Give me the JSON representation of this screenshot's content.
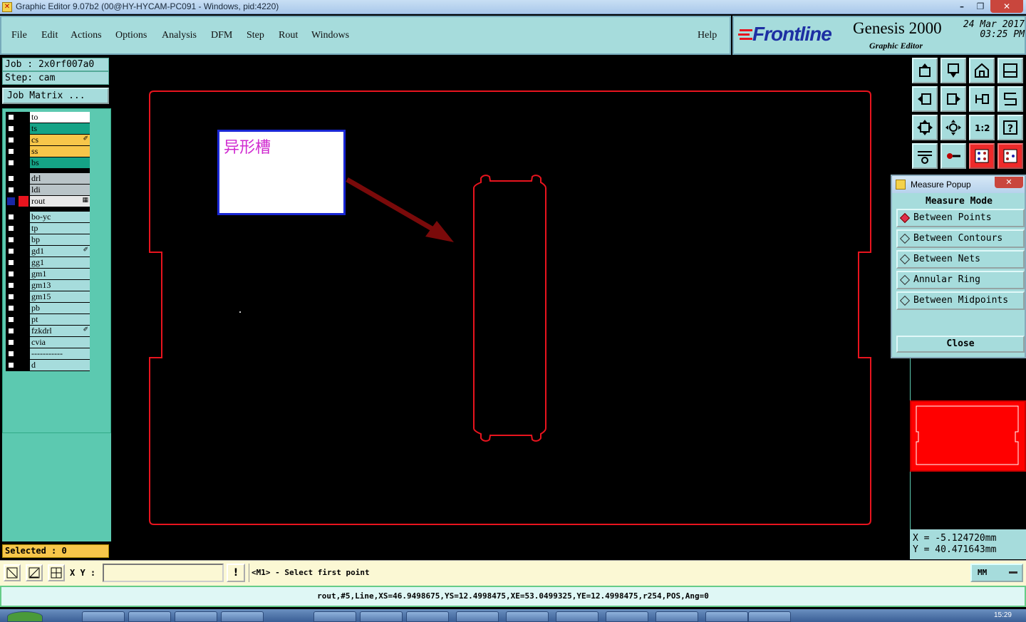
{
  "window": {
    "title": "Graphic Editor 9.07b2 (00@HY-HYCAM-PC091 - Windows, pid:4220)",
    "controls": {
      "minimize": "–",
      "maximize": "❐",
      "close": "✕"
    }
  },
  "menu": {
    "items": [
      "File",
      "Edit",
      "Actions",
      "Options",
      "Analysis",
      "DFM",
      "Step",
      "Rout",
      "Windows"
    ],
    "help": "Help"
  },
  "logo": {
    "brand": "Frontline",
    "product": "Genesis 2000",
    "subtitle": "Graphic Editor",
    "date": "24 Mar 2017",
    "time": "03:25 PM"
  },
  "left": {
    "job": "Job  : 2x0rf007a0",
    "step": "Step: cam",
    "job_matrix": "Job Matrix ...",
    "layers": [
      {
        "name": "to",
        "color": "#ffffff",
        "mark": ""
      },
      {
        "name": "ts",
        "color": "#15a386",
        "mark": ""
      },
      {
        "name": "cs",
        "color": "#f7c64a",
        "mark": "✐"
      },
      {
        "name": "ss",
        "color": "#f7c64a",
        "mark": ""
      },
      {
        "name": "bs",
        "color": "#15a386",
        "mark": ""
      },
      {
        "name": "drl",
        "color": "#b9c4c8",
        "mark": ""
      },
      {
        "name": "ldi",
        "color": "#b9c4c8",
        "mark": ""
      },
      {
        "name": "rout",
        "color": "#e8e8e8",
        "mark": "▦",
        "active": true
      },
      {
        "name": "bo-yc",
        "color": "#a6dcdc",
        "mark": ""
      },
      {
        "name": "tp",
        "color": "#a6dcdc",
        "mark": ""
      },
      {
        "name": "bp",
        "color": "#a6dcdc",
        "mark": ""
      },
      {
        "name": "gd1",
        "color": "#a6dcdc",
        "mark": "✐"
      },
      {
        "name": "gg1",
        "color": "#a6dcdc",
        "mark": ""
      },
      {
        "name": "gm1",
        "color": "#a6dcdc",
        "mark": ""
      },
      {
        "name": "gm13",
        "color": "#a6dcdc",
        "mark": ""
      },
      {
        "name": "gm15",
        "color": "#a6dcdc",
        "mark": ""
      },
      {
        "name": "pb",
        "color": "#a6dcdc",
        "mark": ""
      },
      {
        "name": "pt",
        "color": "#a6dcdc",
        "mark": ""
      },
      {
        "name": "fzkdrl",
        "color": "#a6dcdc",
        "mark": "✐"
      },
      {
        "name": "cvia",
        "color": "#a6dcdc",
        "mark": ""
      },
      {
        "name": "-----------",
        "color": "#a6dcdc",
        "mark": ""
      },
      {
        "name": "d",
        "color": "#a6dcdc",
        "mark": ""
      }
    ],
    "selected": "Selected : 0"
  },
  "canvas": {
    "callout_text": "异形槽",
    "outline_color": "#e8141e",
    "callout_border": "#1927d5",
    "arrow_color": "#7a0a0a"
  },
  "measure_popup": {
    "title": "Measure Popup",
    "mode_label": "Measure Mode",
    "options": [
      "Between Points",
      "Between Contours",
      "Between Nets",
      "Annular Ring",
      "Between Midpoints"
    ],
    "selected_option": "Between Points",
    "close_label": "Close"
  },
  "coords": {
    "x": "X  =  -5.124720mm",
    "y": "Y  =  40.471643mm"
  },
  "bottom": {
    "xy_label": "X Y :",
    "xy_value": "",
    "warn": "!",
    "prompt": "<M1> - Select first point",
    "units": "MM"
  },
  "status": "rout,#5,Line,XS=46.9498675,YS=12.4998475,XE=53.0499325,YE=12.4998475,r254,POS,Ang=0",
  "taskbar": {
    "clock": "15:29"
  }
}
